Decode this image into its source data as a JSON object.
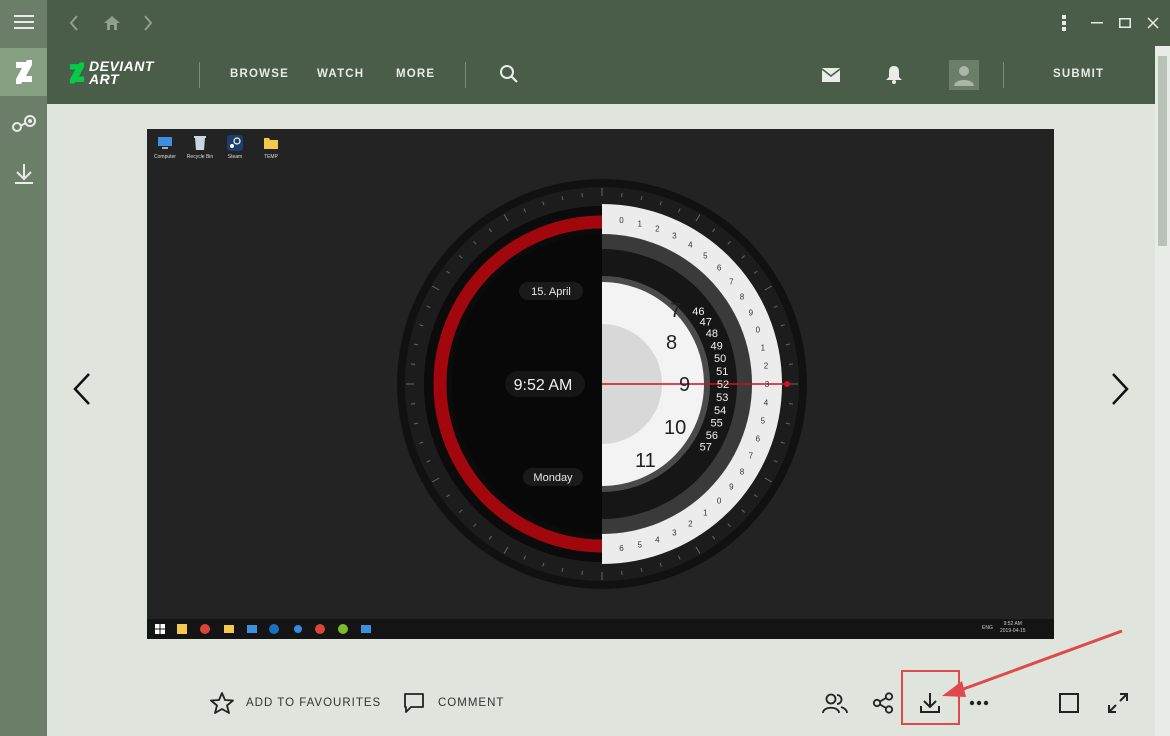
{
  "colors": {
    "rail": "#6b7f68",
    "header": "#4a5d48",
    "content": "#dfe5dd",
    "accent_green": "#05cc47",
    "annotation_red": "#e0494b",
    "clock_red": "#a3070e"
  },
  "rail": {
    "items": [
      {
        "icon": "hamburger-menu-icon"
      },
      {
        "icon": "deviantart-icon"
      },
      {
        "icon": "steam-icon"
      },
      {
        "icon": "download-icon"
      }
    ]
  },
  "titlebar": {
    "icons": [
      "back-arrow-icon",
      "home-icon",
      "forward-arrow-icon",
      "kebab-menu-icon",
      "minimize-icon",
      "maximize-icon",
      "close-icon"
    ]
  },
  "header": {
    "logo_line1": "DEVIANT",
    "logo_line2": "ART",
    "nav": [
      "BROWSE",
      "WATCH",
      "MORE"
    ],
    "submit": "SUBMIT"
  },
  "artwork": {
    "desktop_icons": [
      "Computer",
      "Recycle Bin",
      "Steam",
      "TEMP"
    ],
    "date": "15. April",
    "time": "9:52 AM",
    "day": "Monday",
    "hours_visible": [
      "7",
      "8",
      "9",
      "10",
      "11"
    ],
    "minutes_visible": [
      "46",
      "47",
      "48",
      "49",
      "50",
      "51",
      "52",
      "53",
      "54",
      "55",
      "56",
      "57"
    ],
    "taskbar_time": "9:52 AM",
    "taskbar_date": "2019-04-15",
    "taskbar_lang": "ENG"
  },
  "actions": {
    "favourite": "ADD TO FAVOURITES",
    "comment": "COMMENT"
  }
}
